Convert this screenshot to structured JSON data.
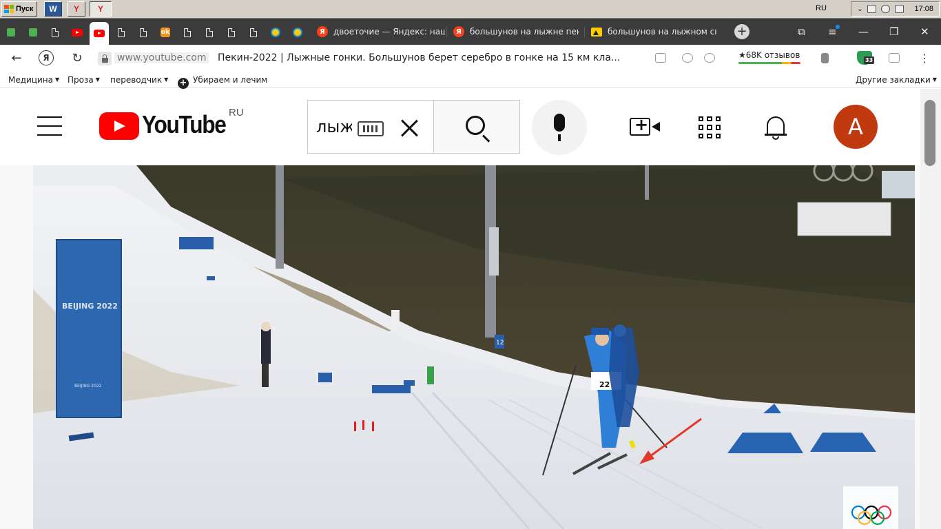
{
  "os": {
    "start_label": "Пуск",
    "quicklaunch": [
      "W",
      "Y",
      "Y"
    ],
    "language": "RU",
    "clock": "17:08"
  },
  "browser": {
    "tabs": [
      {
        "label": "двоеточие — Яндекс: наш",
        "icon": "yandex-icon"
      },
      {
        "label": "большунов на лыжне пеки",
        "icon": "yandex-icon"
      },
      {
        "label": "большунов на лыжном спо",
        "icon": "image-search-icon"
      }
    ],
    "new_tab": "+",
    "address": {
      "yandex_letter": "Я",
      "url": "www.youtube.com",
      "page_title": "Пекин-2022 | Лыжные гонки. Большунов берет серебро в гонке на 15 км кла...",
      "reviews": "★68K отзывов",
      "badge": "33"
    },
    "bookmarks": [
      {
        "label": "Медицина",
        "dropdown": true
      },
      {
        "label": "Проза",
        "dropdown": true
      },
      {
        "label": "переводчик",
        "dropdown": true
      },
      {
        "label": "Убираем и лечим ",
        "dropdown": false
      }
    ],
    "other_bookmarks": "Другие закладки"
  },
  "youtube": {
    "brand": "YouTube",
    "region": "RU",
    "search_value": "лыжи",
    "avatar_letter": "А",
    "colors": {
      "brand_red": "#ff0000",
      "avatar": "#c1390f"
    }
  },
  "video": {
    "banner_text": "BEIJING 2022",
    "banner_small": "BEIJING 2022",
    "skier_bib": "22",
    "pole_sign": "12"
  }
}
